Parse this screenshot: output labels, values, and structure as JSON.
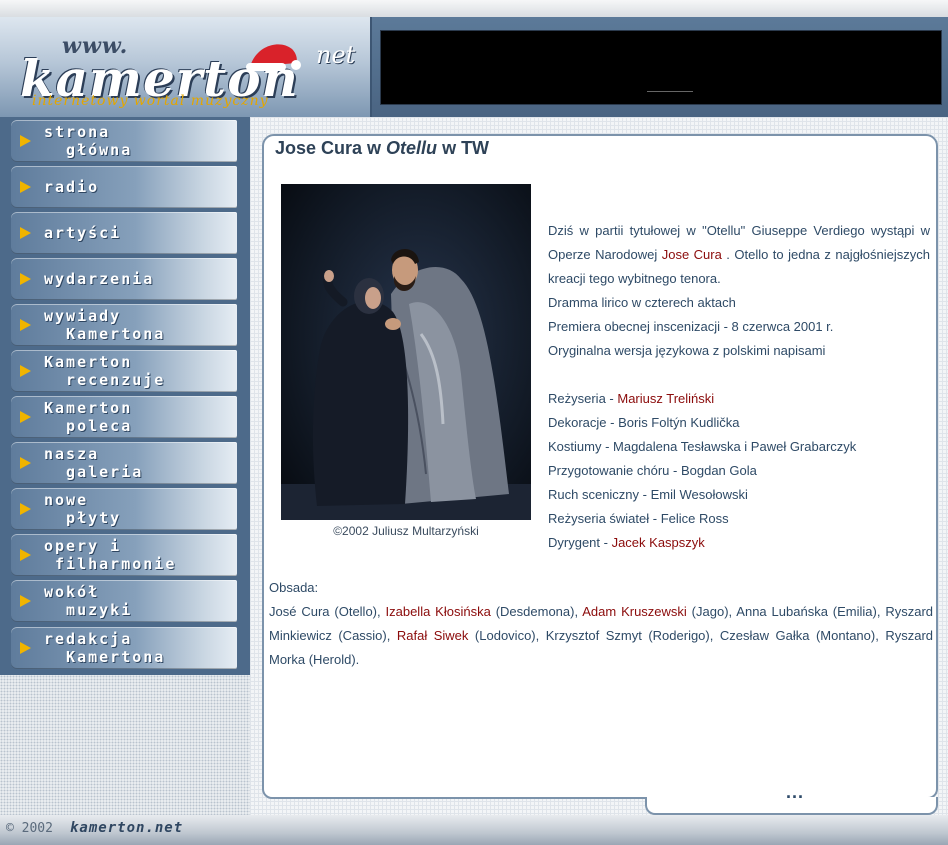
{
  "header": {
    "logo_prefix": "www.",
    "logo_brand": "kamerton",
    "logo_suffix": "net",
    "tagline": "internetowy wortal muzyczny"
  },
  "sidebar": {
    "items": [
      {
        "label": "strona\n  główna"
      },
      {
        "label": "radio"
      },
      {
        "label": "artyści"
      },
      {
        "label": "wydarzenia"
      },
      {
        "label": "wywiady\n  Kamertona"
      },
      {
        "label": "Kamerton\n  recenzuje"
      },
      {
        "label": "Kamerton\n  poleca"
      },
      {
        "label": "nasza\n  galeria"
      },
      {
        "label": "nowe\n  płyty"
      },
      {
        "label": "opery i\n filharmonie"
      },
      {
        "label": "wokół\n  muzyki"
      },
      {
        "label": "redakcja\n  Kamertona"
      }
    ]
  },
  "article": {
    "title_prefix": "Jose Cura w ",
    "title_italic": "Otellu",
    "title_suffix": " w TW",
    "photo_caption": "©2002 Juliusz Multarzyński",
    "desc_part1": "Dziś w partii tytułowej w \"Otellu\" Giuseppe Verdiego wystąpi w Operze Narodowej ",
    "desc_link": "Jose Cura",
    "desc_part2": " . Otello to jedna z najgłośniejszych kreacji tego wybitnego tenora.",
    "line_dramma": "Dramma lirico w czterech aktach",
    "line_premiere": "Premiera obecnej inscenizacji - 8 czerwca 2001 r.",
    "line_version": "Oryginalna wersja językowa z polskimi napisami",
    "credits": [
      {
        "role": "Reżyseria - ",
        "name": "Mariusz Treliński",
        "highlight": true
      },
      {
        "role": "Dekoracje - ",
        "name": "Boris Foltýn Kudlička",
        "highlight": false
      },
      {
        "role": "Kostiumy - ",
        "name": "Magdalena Tesławska i Paweł Grabarczyk",
        "highlight": false
      },
      {
        "role": "Przygotowanie chóru - ",
        "name": "Bogdan Gola",
        "highlight": false
      },
      {
        "role": "Ruch sceniczny - ",
        "name": "Emil Wesołowski",
        "highlight": false
      },
      {
        "role": "Reżyseria świateł - ",
        "name": "Felice Ross",
        "highlight": false
      },
      {
        "role": "Dyrygent - ",
        "name": "Jacek Kaspszyk",
        "highlight": true
      }
    ],
    "cast_heading": "Obsada:",
    "cast": [
      {
        "text": "José Cura (Otello), ",
        "highlight": false
      },
      {
        "text": "Izabella Kłosińska",
        "highlight": true
      },
      {
        "text": " (Desdemona), ",
        "highlight": false
      },
      {
        "text": "Adam Kruszewski",
        "highlight": true
      },
      {
        "text": " (Jago), Anna Lubańska (Emilia), Ryszard Minkiewicz (Cassio), ",
        "highlight": false
      },
      {
        "text": "Rafał Siwek",
        "highlight": true
      },
      {
        "text": " (Lodovico), Krzysztof Szmyt (Roderigo), Czesław Gałka (Montano), Ryszard Morka (Herold).",
        "highlight": false
      }
    ],
    "more": "..."
  },
  "footer": {
    "copyright": "© 2002",
    "site": "kamerton.net"
  },
  "colors": {
    "link_red": "#8b0b0b",
    "text_blue": "#2e4a66",
    "nav_arrow": "#f0b400"
  }
}
